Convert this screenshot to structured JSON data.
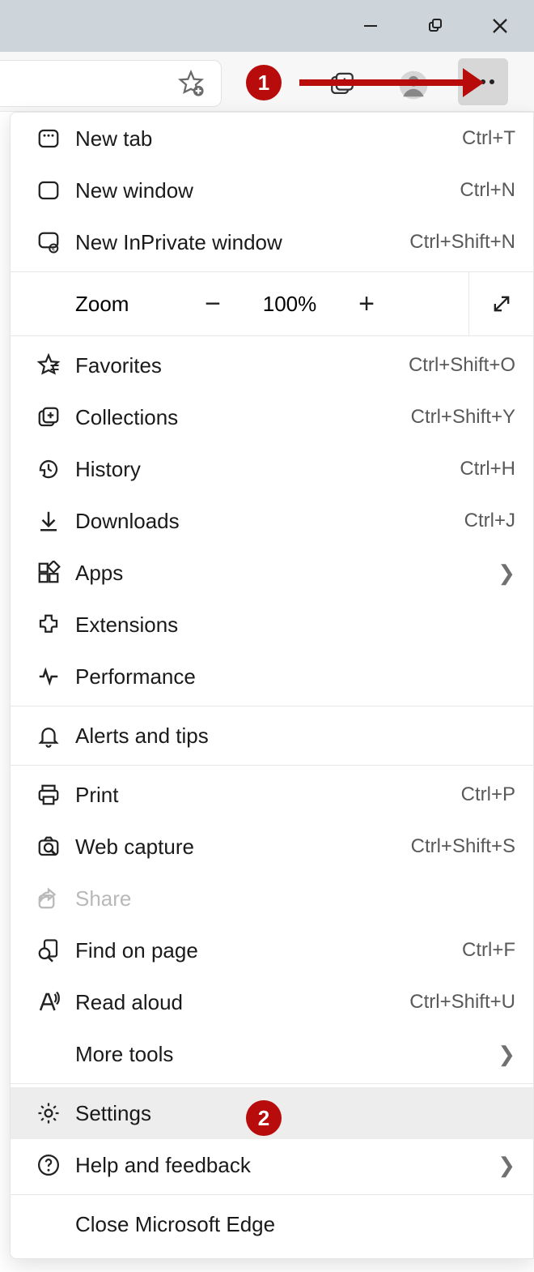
{
  "callouts": {
    "step1": "1",
    "step2": "2"
  },
  "zoom": {
    "label": "Zoom",
    "value": "100%"
  },
  "menu": {
    "new_tab": {
      "label": "New tab",
      "shortcut": "Ctrl+T"
    },
    "new_window": {
      "label": "New window",
      "shortcut": "Ctrl+N"
    },
    "inprivate": {
      "label": "New InPrivate window",
      "shortcut": "Ctrl+Shift+N"
    },
    "favorites": {
      "label": "Favorites",
      "shortcut": "Ctrl+Shift+O"
    },
    "collections": {
      "label": "Collections",
      "shortcut": "Ctrl+Shift+Y"
    },
    "history": {
      "label": "History",
      "shortcut": "Ctrl+H"
    },
    "downloads": {
      "label": "Downloads",
      "shortcut": "Ctrl+J"
    },
    "apps": {
      "label": "Apps"
    },
    "extensions": {
      "label": "Extensions"
    },
    "performance": {
      "label": "Performance"
    },
    "alerts": {
      "label": "Alerts and tips"
    },
    "print": {
      "label": "Print",
      "shortcut": "Ctrl+P"
    },
    "web_capture": {
      "label": "Web capture",
      "shortcut": "Ctrl+Shift+S"
    },
    "share": {
      "label": "Share"
    },
    "find": {
      "label": "Find on page",
      "shortcut": "Ctrl+F"
    },
    "read_aloud": {
      "label": "Read aloud",
      "shortcut": "Ctrl+Shift+U"
    },
    "more_tools": {
      "label": "More tools"
    },
    "settings": {
      "label": "Settings"
    },
    "help": {
      "label": "Help and feedback"
    },
    "close": {
      "label": "Close Microsoft Edge"
    }
  }
}
